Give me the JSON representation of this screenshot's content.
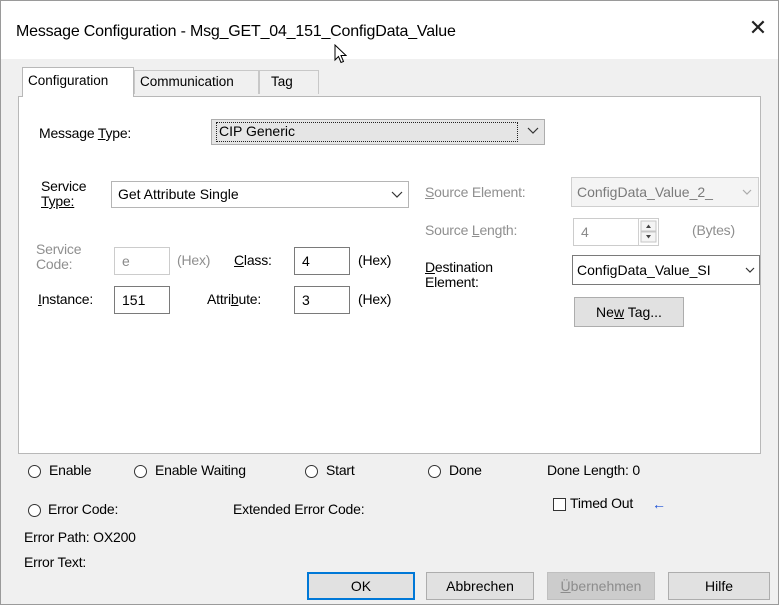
{
  "window": {
    "title": "Message Configuration - Msg_GET_04_151_ConfigData_Value",
    "close_glyph": "✕"
  },
  "tabs": [
    {
      "label": "Configuration",
      "active": true
    },
    {
      "label": "Communication",
      "active": false
    },
    {
      "label": "Tag",
      "active": false
    }
  ],
  "config": {
    "message_type_label_pre": "Message ",
    "message_type_label_u": "T",
    "message_type_label_post": "ype:",
    "message_type_value": "CIP Generic",
    "service_type_label_line1": "Service",
    "service_type_label_line2": "Type:",
    "service_type_value": "Get Attribute Single",
    "service_code_label_line1": "Service",
    "service_code_label_line2": "Code:",
    "service_code_value": "e",
    "hex1": "(Hex)",
    "class_label_u": "C",
    "class_label_post": "lass:",
    "class_value": "4",
    "hex2": "(Hex)",
    "instance_label_u": "I",
    "instance_label_post": "nstance:",
    "instance_value": "151",
    "attribute_label_pre": "Attri",
    "attribute_label_u": "b",
    "attribute_label_post": "ute:",
    "attribute_value": "3",
    "hex3": "(Hex)",
    "source_element_label_u": "S",
    "source_element_label_post": "ource Element:",
    "source_element_value": "ConfigData_Value_2_",
    "source_length_label_pre": "Source ",
    "source_length_label_u": "L",
    "source_length_label_post": "ength:",
    "source_length_value": "4",
    "bytes_label": "(Bytes)",
    "destination_label_line1_u": "D",
    "destination_label_line1_post": "estination",
    "destination_label_line2": "Element:",
    "destination_value": "ConfigData_Value_SI",
    "new_tag_pre": "Ne",
    "new_tag_u": "w",
    "new_tag_post": " Tag..."
  },
  "status": {
    "enable": "Enable",
    "enable_waiting": "Enable Waiting",
    "start": "Start",
    "done": "Done",
    "done_length": "Done Length: 0",
    "error_code": "Error Code:",
    "extended_error_code": "Extended Error Code:",
    "timed_out": "Timed Out",
    "timed_out_arrow": "←",
    "error_path": "Error Path: OX200",
    "error_text": "Error Text:"
  },
  "buttons": {
    "ok": "OK",
    "cancel": "Abbrechen",
    "apply_u": "Ü",
    "apply_post": "bernehmen",
    "help": "Hilfe"
  }
}
